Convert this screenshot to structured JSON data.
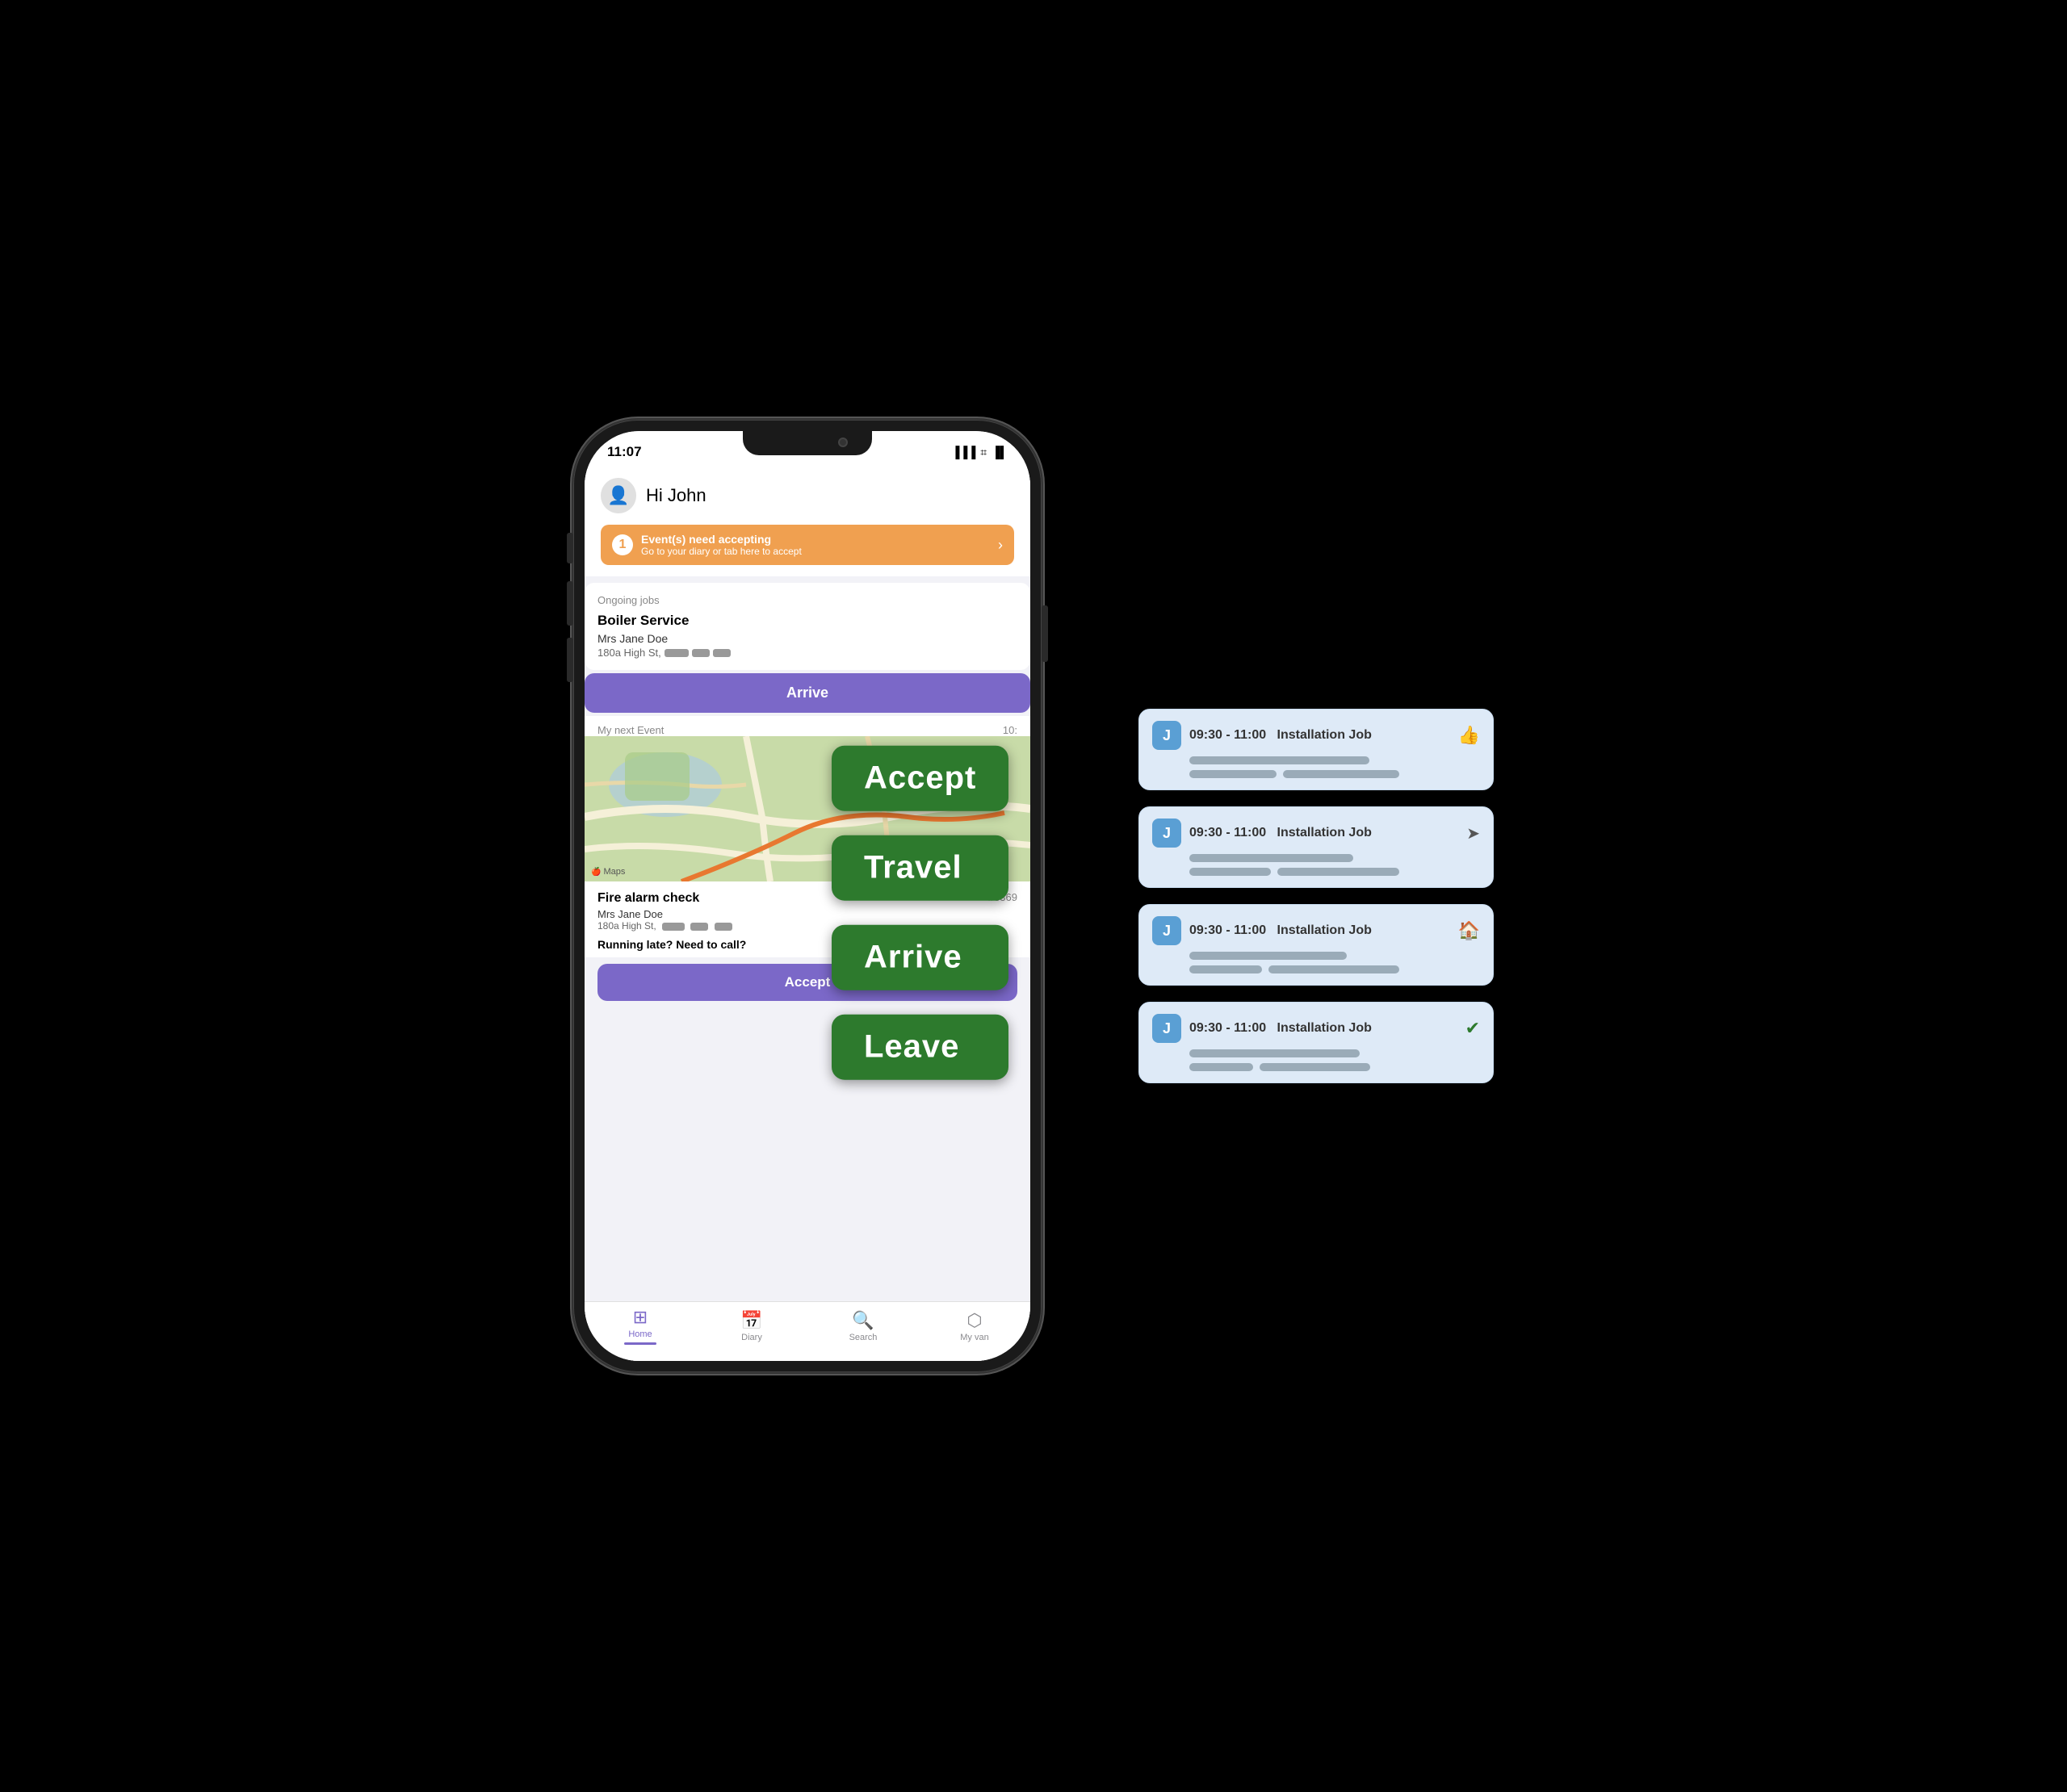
{
  "phone": {
    "time": "11:07",
    "greeting": "Hi John",
    "notification": {
      "badge": "1",
      "line1": "Event(s) need accepting",
      "line2": "Go to your diary or tab here to accept"
    },
    "ongoing_jobs_label": "Ongoing jobs",
    "job1": {
      "title": "Boiler Service",
      "client": "Mrs Jane Doe",
      "address": "180a High St,"
    },
    "arrive_button": "Arrive",
    "next_event_label": "My next Event",
    "next_event_time": "10:",
    "maps_label": "Maps",
    "job2": {
      "title": "Fire alarm check",
      "ref": "#3369",
      "client": "Mrs Jane Doe",
      "address": "180a High St,"
    },
    "running_late": "Running late? Need to call?",
    "accept_button": "Accept",
    "tabs": {
      "home": "Home",
      "diary": "Diary",
      "search": "Search",
      "my_van": "My van"
    }
  },
  "labels": {
    "accept": "Accept",
    "travel": "Travel",
    "arrive": "Arrive",
    "leave": "Leave"
  },
  "cards": [
    {
      "avatar": "J",
      "time_title": "09:30 - 11:00   Installation Job",
      "icon_type": "thumbs_up"
    },
    {
      "avatar": "J",
      "time_title": "09:30 - 11:00   Installation Job",
      "icon_type": "navigate"
    },
    {
      "avatar": "J",
      "time_title": "09:30 - 11:00   Installation Job",
      "icon_type": "home"
    },
    {
      "avatar": "J",
      "time_title": "09:30 - 11:00   Installation Job",
      "icon_type": "check"
    }
  ]
}
